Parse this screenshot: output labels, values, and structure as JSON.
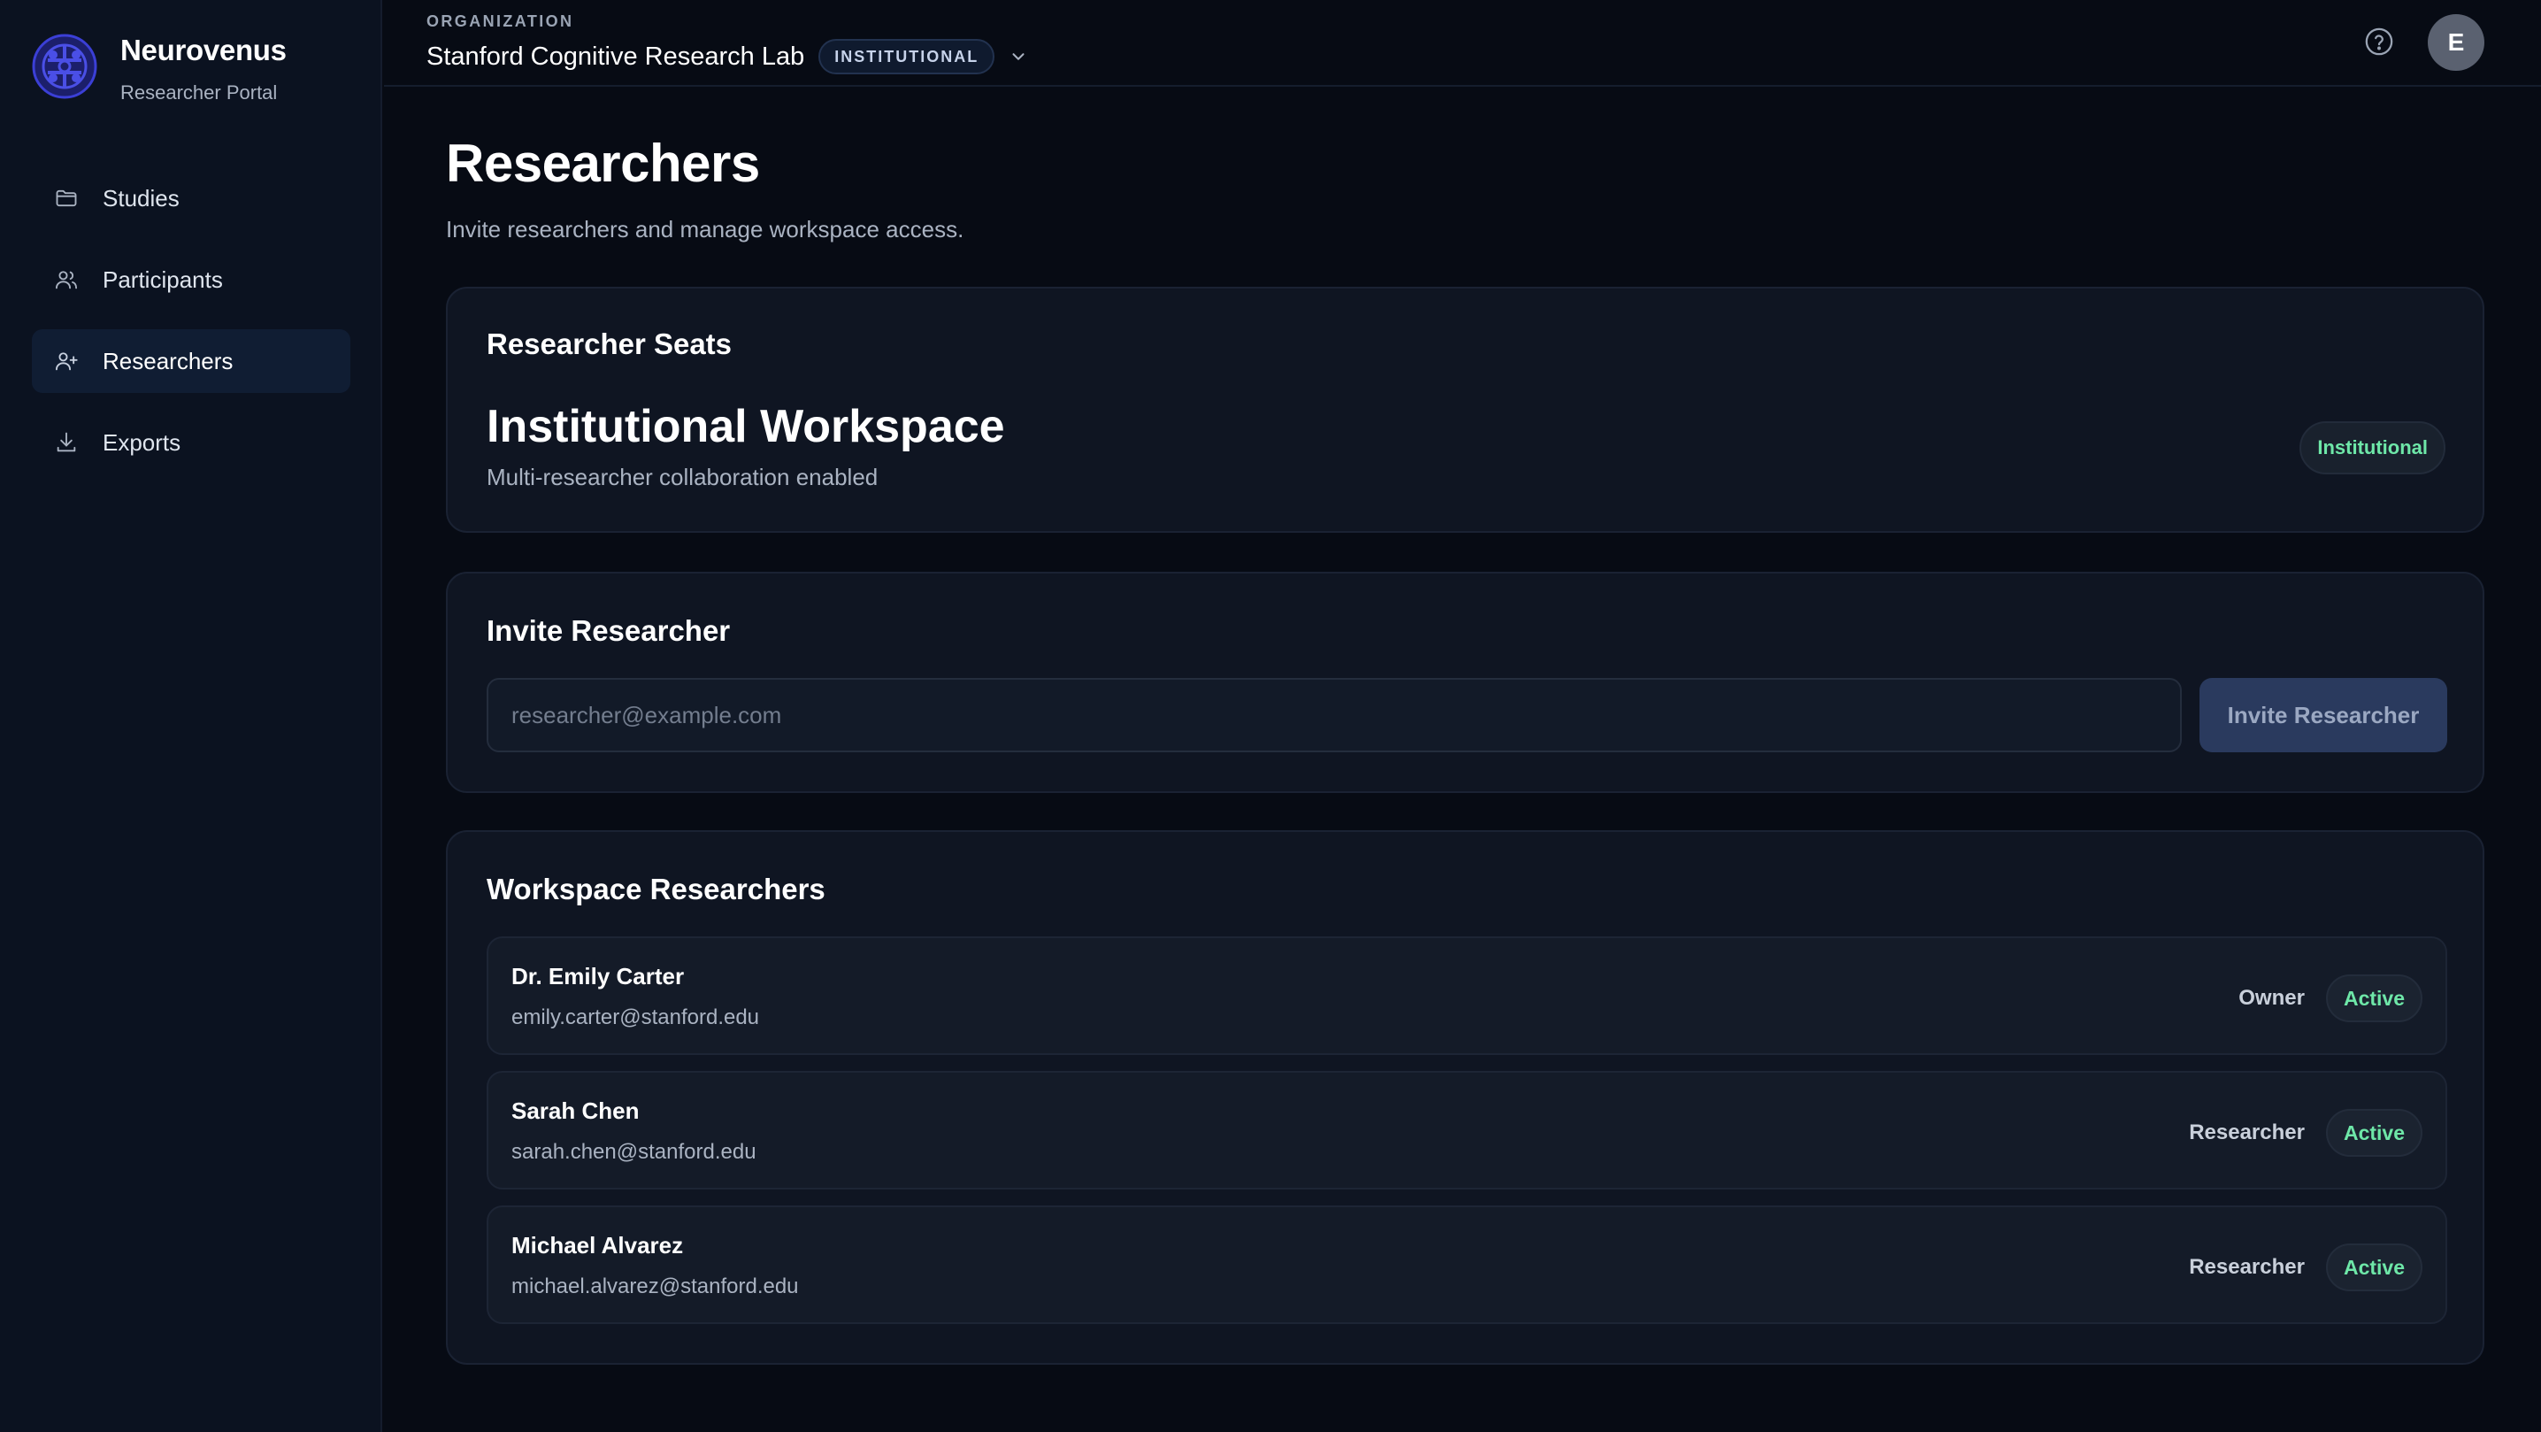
{
  "brand": {
    "name": "Neurovenus",
    "subtitle": "Researcher Portal"
  },
  "sidebar": {
    "items": [
      {
        "label": "Studies",
        "icon": "folder-icon",
        "active": false
      },
      {
        "label": "Participants",
        "icon": "users-icon",
        "active": false
      },
      {
        "label": "Researchers",
        "icon": "user-plus-icon",
        "active": true
      },
      {
        "label": "Exports",
        "icon": "download-icon",
        "active": false
      }
    ]
  },
  "topbar": {
    "org_caption": "ORGANIZATION",
    "org_name": "Stanford Cognitive Research Lab",
    "org_badge": "INSTITUTIONAL",
    "avatar_initial": "E"
  },
  "page": {
    "title": "Researchers",
    "subtitle": "Invite researchers and manage workspace access."
  },
  "seats": {
    "title": "Researcher Seats",
    "plan": "Institutional Workspace",
    "description": "Multi-researcher collaboration enabled",
    "badge": "Institutional"
  },
  "invite": {
    "title": "Invite Researcher",
    "placeholder": "researcher@example.com",
    "value": "",
    "button_label": "Invite Researcher"
  },
  "workspace": {
    "title": "Workspace Researchers",
    "researchers": [
      {
        "name": "Dr. Emily Carter",
        "email": "emily.carter@stanford.edu",
        "role": "Owner",
        "status": "Active"
      },
      {
        "name": "Sarah Chen",
        "email": "sarah.chen@stanford.edu",
        "role": "Researcher",
        "status": "Active"
      },
      {
        "name": "Michael Alvarez",
        "email": "michael.alvarez@stanford.edu",
        "role": "Researcher",
        "status": "Active"
      }
    ]
  },
  "colors": {
    "background": "#070b14",
    "sidebar": "#0b1220",
    "accent_active": "#101d33",
    "status_green": "#6ee7a8",
    "logo_blue": "#3b3fd6"
  }
}
